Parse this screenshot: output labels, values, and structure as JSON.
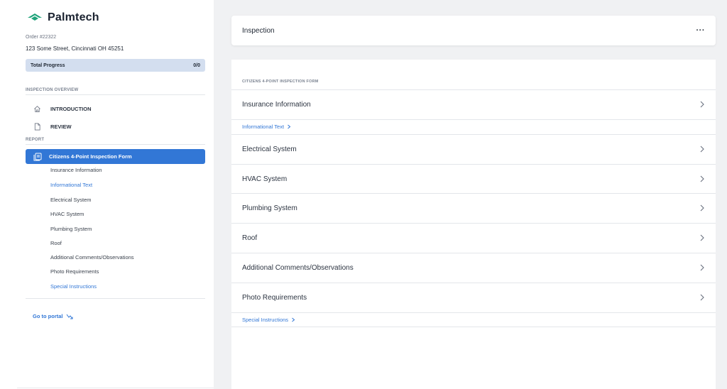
{
  "brand": {
    "name": "Palmtech",
    "accent": "#3277d6",
    "logo_color": "#1fa37a",
    "icon": "palmtech-logo"
  },
  "order": {
    "number": "Order #22322",
    "address": "123 Some Street, Cincinnati OH 45251"
  },
  "progress": {
    "label": "Total Progress",
    "value": "0/0",
    "fraction": 0
  },
  "sidebar": {
    "overview_label": "INSPECTION OVERVIEW",
    "overview_items": [
      {
        "label": "INTRODUCTION",
        "icon": "home-icon"
      },
      {
        "label": "REVIEW",
        "icon": "document-icon"
      }
    ],
    "report_label": "REPORT",
    "active_form": {
      "label": "Citizens 4-Point Inspection Form",
      "icon": "form-icon"
    },
    "sub_items": [
      {
        "label": "Insurance Information",
        "link": false
      },
      {
        "label": "Informational Text",
        "link": true
      },
      {
        "label": "Electrical System",
        "link": false
      },
      {
        "label": "HVAC System",
        "link": false
      },
      {
        "label": "Plumbing System",
        "link": false
      },
      {
        "label": "Roof",
        "link": false
      },
      {
        "label": "Additional Comments/Observations",
        "link": false
      },
      {
        "label": "Photo Requirements",
        "link": false
      },
      {
        "label": "Special Instructions",
        "link": true
      }
    ],
    "portal_link": "Go to portal"
  },
  "main": {
    "header_title": "Inspection",
    "more_label": "···",
    "form_label": "CITIZENS 4-POINT INSPECTION FORM",
    "rows": [
      "Insurance Information",
      "Electrical System",
      "HVAC System",
      "Plumbing System",
      "Roof",
      "Additional Comments/Observations",
      "Photo Requirements"
    ],
    "informational_text_link": "Informational Text",
    "special_instructions_link": "Special Instructions"
  }
}
